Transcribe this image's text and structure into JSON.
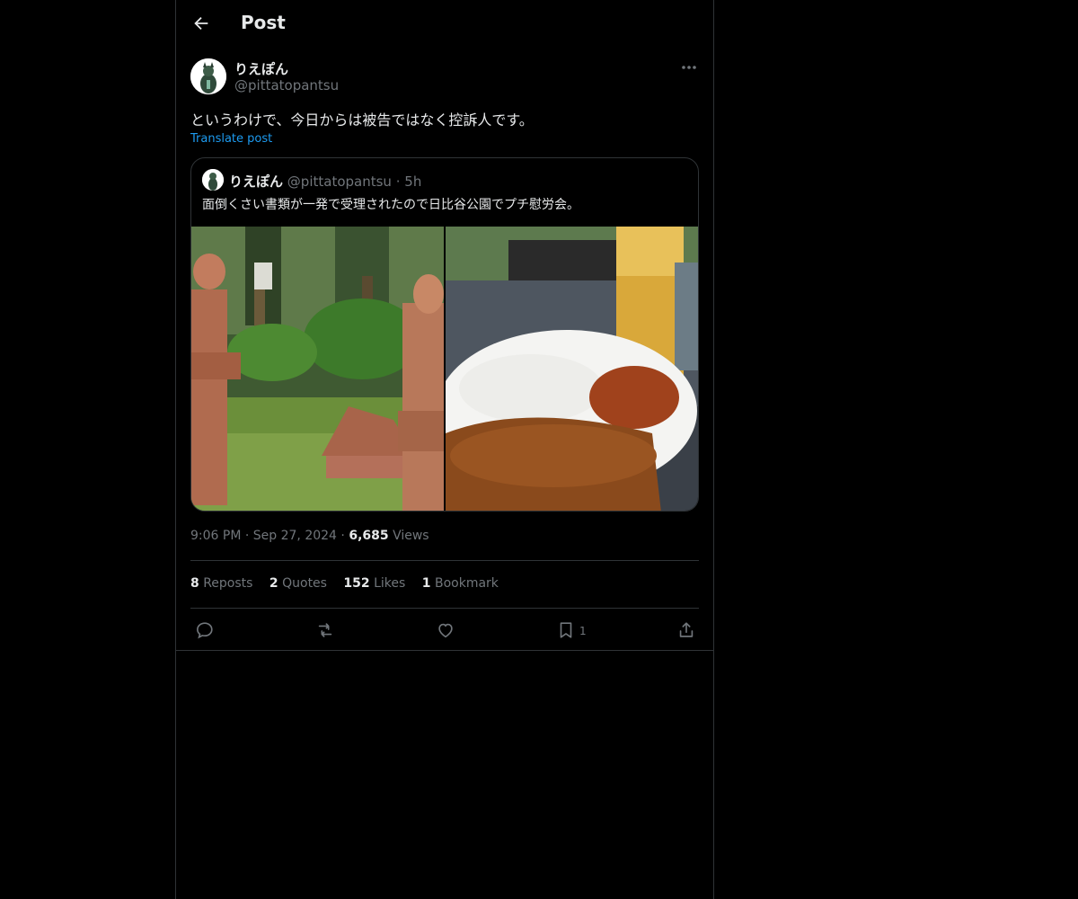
{
  "header": {
    "title": "Post"
  },
  "author": {
    "name": "りえぽん",
    "handle": "@pittatopantsu"
  },
  "post": {
    "text": "というわけで、今日からは被告ではなく控訴人です。",
    "translate_label": "Translate post"
  },
  "quote": {
    "name": "りえぽん",
    "handle": "@pittatopantsu",
    "separator": "·",
    "time": "5h",
    "text": "面倒くさい書類が一発で受理されたので日比谷公園でプチ慰労会。"
  },
  "meta": {
    "time": "9:06 PM",
    "separator": "·",
    "date": "Sep 27, 2024",
    "views_count": "6,685",
    "views_label": "Views"
  },
  "stats": {
    "reposts_count": "8",
    "reposts_label": "Reposts",
    "quotes_count": "2",
    "quotes_label": "Quotes",
    "likes_count": "152",
    "likes_label": "Likes",
    "bookmarks_count": "1",
    "bookmarks_label": "Bookmark"
  },
  "actions": {
    "bookmark_count": "1"
  },
  "icons": [
    "back-arrow-icon",
    "more-icon",
    "reply-icon",
    "repost-icon",
    "like-icon",
    "bookmark-icon",
    "share-icon"
  ],
  "colors": {
    "background": "#000000",
    "text": "#e7e9ea",
    "secondary": "#71767b",
    "accent": "#1d9bf0",
    "border": "#2f3336"
  }
}
